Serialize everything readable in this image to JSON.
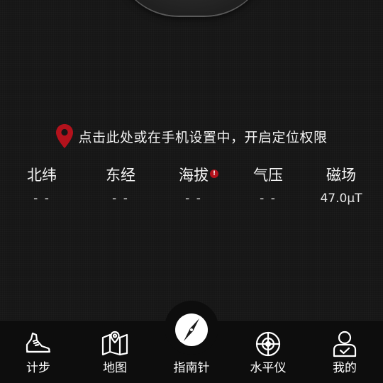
{
  "location": {
    "prompt": "点击此处或在手机设置中，开启定位权限",
    "pin_color": "#b3121c"
  },
  "stats": [
    {
      "label": "北纬",
      "value": "- -"
    },
    {
      "label": "东经",
      "value": "- -"
    },
    {
      "label": "海拔",
      "value": "- -",
      "alert": "!"
    },
    {
      "label": "气压",
      "value": "- -"
    },
    {
      "label": "磁场",
      "value": "47.0μT"
    }
  ],
  "tabs": [
    {
      "label": "计步",
      "icon": "sneaker-icon"
    },
    {
      "label": "地图",
      "icon": "map-icon"
    },
    {
      "label": "指南针",
      "icon": "compass-icon",
      "active": true
    },
    {
      "label": "水平仪",
      "icon": "level-icon"
    },
    {
      "label": "我的",
      "icon": "profile-icon"
    }
  ]
}
